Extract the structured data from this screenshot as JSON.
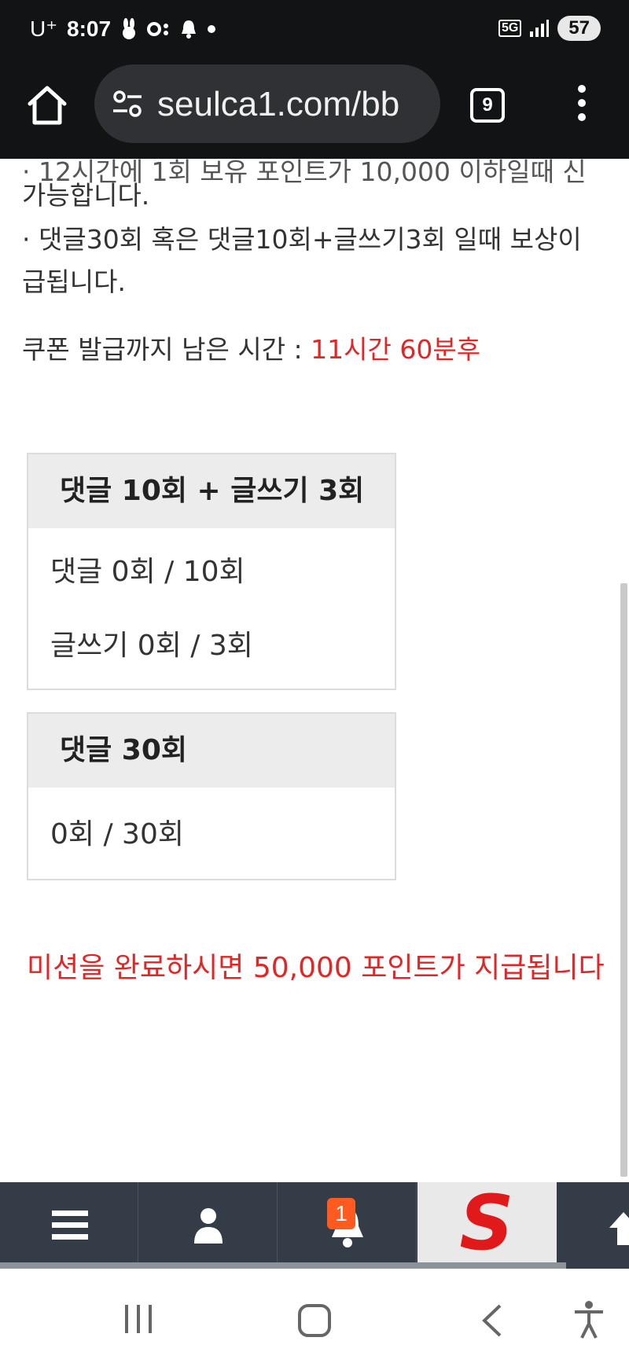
{
  "status_bar": {
    "carrier": "U⁺",
    "time": "8:07",
    "network": "5G",
    "battery": "57"
  },
  "browser": {
    "url": "seulca1.com/bb",
    "tab_count": "9"
  },
  "content": {
    "cut_line": "· 12시간에 1회 보유 포인트가 10,000 이하일때 신",
    "line_1": "가능합니다.",
    "line_2": "· 댓글30회 혹은 댓글10회+글쓰기3회 일때 보상이",
    "line_3": "급됩니다.",
    "countdown_label": "쿠폰 발급까지 남은 시간 : ",
    "countdown_value": "11시간 60분후",
    "mission_a": {
      "title": "댓글 10회 + 글쓰기 3회",
      "comment_progress": "댓글 0회 / 10회",
      "post_progress": "글쓰기 0회 / 3회"
    },
    "mission_b": {
      "title": "댓글 30회",
      "comment_progress": "0회 / 30회"
    },
    "reward_text": "미션을 완료하시면 50,000 포인트가 지급됩니다"
  },
  "bottom_nav": {
    "notification_count": "1",
    "logo_letter": "S"
  },
  "colors": {
    "accent_red": "#e32526",
    "nav_bg": "#343d47",
    "badge": "#ff5a1f"
  }
}
